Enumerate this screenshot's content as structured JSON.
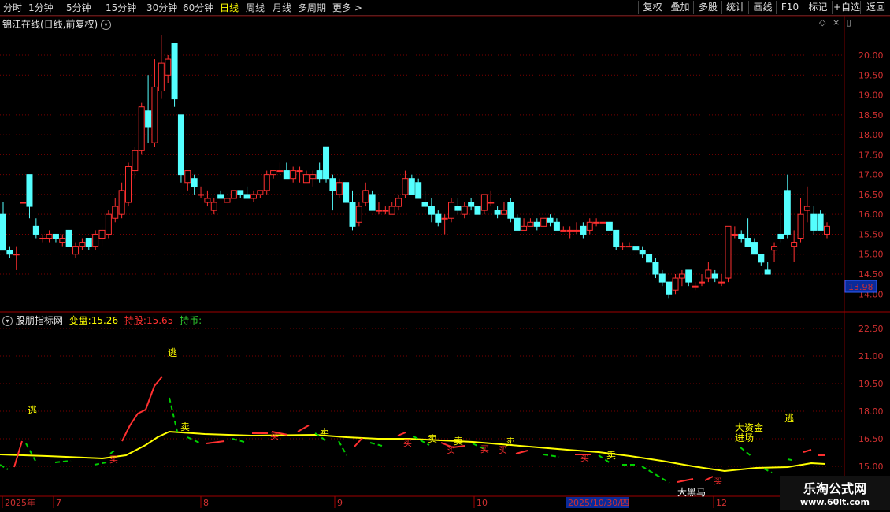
{
  "toolbar": {
    "left_tabs": [
      "分时",
      "1分钟",
      "5分钟",
      "15分钟",
      "30分钟",
      "60分钟",
      "日线",
      "周线",
      "月线",
      "多周期",
      "更多 >"
    ],
    "active_tab": "日线",
    "right_buttons": [
      "复权",
      "叠加",
      "多股",
      "统计",
      "画线",
      "F10",
      "标记",
      "+自选",
      "返回"
    ]
  },
  "main_chart": {
    "title": "锦江在线(日线,前复权)",
    "price_ticks": [
      "20.00",
      "19.50",
      "19.00",
      "18.50",
      "18.00",
      "17.50",
      "17.00",
      "16.50",
      "16.00",
      "15.50",
      "15.00",
      "14.50"
    ],
    "current_price": "13.98",
    "current_price_partial": "14.00"
  },
  "indicator": {
    "name": "股朋指标网",
    "items": [
      {
        "label": "变盘:",
        "value": "15.26",
        "color": "#ffff00"
      },
      {
        "label": "持股:",
        "value": "15.65",
        "color": "#ff3030"
      },
      {
        "label": "持币:",
        "value": "-",
        "color": "#30d030"
      }
    ],
    "ticks": [
      "22.50",
      "21.00",
      "19.50",
      "18.00",
      "16.50",
      "15.00"
    ],
    "annotations": {
      "escape": "逃",
      "sell": "卖",
      "buy": "买",
      "big_fund_line1": "大资金",
      "big_fund_line2": "进场",
      "dark_horse": "大黑马"
    }
  },
  "date_axis": {
    "labels": [
      "2025年",
      "7",
      "8",
      "9",
      "10",
      "12"
    ],
    "highlight": "2025/10/30/四"
  },
  "watermark": {
    "title": "乐淘公式网",
    "url": "www.60lt.com"
  },
  "colors": {
    "up": "#ff3030",
    "down": "#54ffff",
    "grid": "#7a0000",
    "line_yellow": "#ffff00",
    "line_green": "#00d000"
  },
  "chart_data": {
    "type": "candlestick",
    "title": "锦江在线(日线,前复权)",
    "ylim": [
      14.0,
      20.5
    ],
    "candles": [
      {
        "o": 16.0,
        "h": 16.3,
        "l": 15.2,
        "c": 15.1
      },
      {
        "o": 15.1,
        "h": 15.2,
        "l": 14.9,
        "c": 15.0
      },
      {
        "o": 15.0,
        "h": 15.2,
        "l": 14.6,
        "c": 15.0
      },
      {
        "o": 16.3,
        "h": 16.3,
        "l": 16.3,
        "c": 16.3
      },
      {
        "o": 17.0,
        "h": 17.0,
        "l": 15.9,
        "c": 16.2
      },
      {
        "o": 15.7,
        "h": 15.9,
        "l": 15.4,
        "c": 15.5
      },
      {
        "o": 15.4,
        "h": 15.5,
        "l": 15.3,
        "c": 15.4
      },
      {
        "o": 15.4,
        "h": 15.6,
        "l": 15.3,
        "c": 15.5
      },
      {
        "o": 15.5,
        "h": 15.5,
        "l": 15.3,
        "c": 15.4
      },
      {
        "o": 15.3,
        "h": 15.5,
        "l": 15.2,
        "c": 15.4
      },
      {
        "o": 15.6,
        "h": 15.6,
        "l": 15.2,
        "c": 15.2
      },
      {
        "o": 15.0,
        "h": 15.3,
        "l": 14.9,
        "c": 15.2
      },
      {
        "o": 15.2,
        "h": 15.4,
        "l": 15.1,
        "c": 15.3
      },
      {
        "o": 15.4,
        "h": 15.4,
        "l": 15.1,
        "c": 15.2
      },
      {
        "o": 15.2,
        "h": 15.6,
        "l": 15.1,
        "c": 15.5
      },
      {
        "o": 15.4,
        "h": 15.7,
        "l": 15.2,
        "c": 15.6
      },
      {
        "o": 15.5,
        "h": 16.1,
        "l": 15.4,
        "c": 16.0
      },
      {
        "o": 15.9,
        "h": 16.4,
        "l": 15.8,
        "c": 16.2
      },
      {
        "o": 16.0,
        "h": 16.8,
        "l": 15.9,
        "c": 16.6
      },
      {
        "o": 16.3,
        "h": 17.3,
        "l": 16.2,
        "c": 17.2
      },
      {
        "o": 17.1,
        "h": 17.7,
        "l": 16.9,
        "c": 17.6
      },
      {
        "o": 17.6,
        "h": 18.8,
        "l": 17.5,
        "c": 18.7
      },
      {
        "o": 18.6,
        "h": 19.5,
        "l": 17.8,
        "c": 18.2
      },
      {
        "o": 17.8,
        "h": 19.9,
        "l": 17.7,
        "c": 19.2
      },
      {
        "o": 19.1,
        "h": 20.5,
        "l": 18.9,
        "c": 19.8
      },
      {
        "o": 19.5,
        "h": 20.0,
        "l": 19.3,
        "c": 19.9
      },
      {
        "o": 20.3,
        "h": 20.3,
        "l": 18.7,
        "c": 18.9
      },
      {
        "o": 18.5,
        "h": 18.5,
        "l": 16.8,
        "c": 17.0
      },
      {
        "o": 16.8,
        "h": 17.1,
        "l": 16.6,
        "c": 17.1
      },
      {
        "o": 16.9,
        "h": 17.0,
        "l": 16.5,
        "c": 16.7
      },
      {
        "o": 16.5,
        "h": 16.7,
        "l": 16.4,
        "c": 16.5
      },
      {
        "o": 16.3,
        "h": 16.6,
        "l": 16.2,
        "c": 16.4
      },
      {
        "o": 16.1,
        "h": 16.4,
        "l": 16.0,
        "c": 16.3
      },
      {
        "o": 16.5,
        "h": 16.6,
        "l": 16.4,
        "c": 16.4
      },
      {
        "o": 16.3,
        "h": 16.4,
        "l": 16.3,
        "c": 16.4
      },
      {
        "o": 16.4,
        "h": 16.6,
        "l": 16.4,
        "c": 16.6
      },
      {
        "o": 16.6,
        "h": 16.6,
        "l": 16.4,
        "c": 16.5
      },
      {
        "o": 16.5,
        "h": 16.7,
        "l": 16.4,
        "c": 16.4
      },
      {
        "o": 16.4,
        "h": 16.6,
        "l": 16.3,
        "c": 16.5
      },
      {
        "o": 16.5,
        "h": 16.6,
        "l": 16.4,
        "c": 16.6
      },
      {
        "o": 16.6,
        "h": 17.1,
        "l": 16.5,
        "c": 17.0
      },
      {
        "o": 17.0,
        "h": 17.1,
        "l": 16.9,
        "c": 17.1
      },
      {
        "o": 17.1,
        "h": 17.3,
        "l": 17.0,
        "c": 17.1
      },
      {
        "o": 17.1,
        "h": 17.3,
        "l": 16.9,
        "c": 16.9
      },
      {
        "o": 16.9,
        "h": 17.2,
        "l": 16.8,
        "c": 17.1
      },
      {
        "o": 17.1,
        "h": 17.2,
        "l": 16.8,
        "c": 17.1
      },
      {
        "o": 16.8,
        "h": 17.1,
        "l": 16.8,
        "c": 17.0
      },
      {
        "o": 16.9,
        "h": 17.1,
        "l": 16.7,
        "c": 17.0
      },
      {
        "o": 17.1,
        "h": 17.3,
        "l": 16.8,
        "c": 16.9
      },
      {
        "o": 17.7,
        "h": 17.7,
        "l": 16.8,
        "c": 16.9
      },
      {
        "o": 16.9,
        "h": 17.0,
        "l": 16.1,
        "c": 16.6
      },
      {
        "o": 16.5,
        "h": 16.9,
        "l": 16.4,
        "c": 16.8
      },
      {
        "o": 16.8,
        "h": 16.8,
        "l": 16.3,
        "c": 16.3
      },
      {
        "o": 16.3,
        "h": 16.6,
        "l": 15.6,
        "c": 15.7
      },
      {
        "o": 15.8,
        "h": 16.3,
        "l": 15.7,
        "c": 16.2
      },
      {
        "o": 16.3,
        "h": 16.8,
        "l": 16.2,
        "c": 16.6
      },
      {
        "o": 16.5,
        "h": 16.6,
        "l": 16.1,
        "c": 16.1
      },
      {
        "o": 16.1,
        "h": 16.3,
        "l": 16.0,
        "c": 16.1
      },
      {
        "o": 16.1,
        "h": 16.2,
        "l": 16.0,
        "c": 16.1
      },
      {
        "o": 16.0,
        "h": 16.3,
        "l": 16.0,
        "c": 16.2
      },
      {
        "o": 16.2,
        "h": 16.5,
        "l": 16.1,
        "c": 16.4
      },
      {
        "o": 16.5,
        "h": 17.1,
        "l": 16.4,
        "c": 16.9
      },
      {
        "o": 16.9,
        "h": 17.0,
        "l": 16.5,
        "c": 16.5
      },
      {
        "o": 16.8,
        "h": 16.9,
        "l": 16.4,
        "c": 16.4
      },
      {
        "o": 16.3,
        "h": 16.6,
        "l": 16.1,
        "c": 16.2
      },
      {
        "o": 16.2,
        "h": 16.4,
        "l": 15.8,
        "c": 16.0
      },
      {
        "o": 16.0,
        "h": 16.1,
        "l": 15.7,
        "c": 15.8
      },
      {
        "o": 15.9,
        "h": 16.0,
        "l": 15.5,
        "c": 15.9
      },
      {
        "o": 15.9,
        "h": 16.4,
        "l": 15.8,
        "c": 16.3
      },
      {
        "o": 16.2,
        "h": 16.4,
        "l": 16.0,
        "c": 16.1
      },
      {
        "o": 16.0,
        "h": 16.3,
        "l": 15.9,
        "c": 16.2
      },
      {
        "o": 16.3,
        "h": 16.4,
        "l": 16.1,
        "c": 16.2
      },
      {
        "o": 16.2,
        "h": 16.2,
        "l": 16.0,
        "c": 16.0
      },
      {
        "o": 16.1,
        "h": 16.5,
        "l": 16.0,
        "c": 16.5
      },
      {
        "o": 16.3,
        "h": 16.6,
        "l": 16.2,
        "c": 16.3
      },
      {
        "o": 16.1,
        "h": 16.2,
        "l": 15.9,
        "c": 16.0
      },
      {
        "o": 16.0,
        "h": 16.3,
        "l": 16.0,
        "c": 16.1
      },
      {
        "o": 16.3,
        "h": 16.4,
        "l": 15.8,
        "c": 15.9
      },
      {
        "o": 15.9,
        "h": 16.0,
        "l": 15.6,
        "c": 15.6
      },
      {
        "o": 15.6,
        "h": 15.9,
        "l": 15.6,
        "c": 15.7
      },
      {
        "o": 15.7,
        "h": 15.9,
        "l": 15.7,
        "c": 15.8
      },
      {
        "o": 15.8,
        "h": 15.9,
        "l": 15.6,
        "c": 15.7
      },
      {
        "o": 15.7,
        "h": 15.9,
        "l": 15.7,
        "c": 15.9
      },
      {
        "o": 15.9,
        "h": 16.0,
        "l": 15.7,
        "c": 15.8
      },
      {
        "o": 15.8,
        "h": 15.9,
        "l": 15.6,
        "c": 15.6
      },
      {
        "o": 15.6,
        "h": 15.7,
        "l": 15.6,
        "c": 15.6
      },
      {
        "o": 15.6,
        "h": 15.7,
        "l": 15.4,
        "c": 15.6
      },
      {
        "o": 15.6,
        "h": 15.8,
        "l": 15.5,
        "c": 15.6
      },
      {
        "o": 15.7,
        "h": 15.8,
        "l": 15.4,
        "c": 15.5
      },
      {
        "o": 15.6,
        "h": 15.9,
        "l": 15.5,
        "c": 15.8
      },
      {
        "o": 15.8,
        "h": 15.9,
        "l": 15.7,
        "c": 15.8
      },
      {
        "o": 15.8,
        "h": 15.9,
        "l": 15.6,
        "c": 15.8
      },
      {
        "o": 15.8,
        "h": 15.8,
        "l": 15.6,
        "c": 15.6
      },
      {
        "o": 15.6,
        "h": 15.6,
        "l": 15.1,
        "c": 15.2
      },
      {
        "o": 15.2,
        "h": 15.3,
        "l": 15.1,
        "c": 15.2
      },
      {
        "o": 15.2,
        "h": 15.3,
        "l": 15.2,
        "c": 15.2
      },
      {
        "o": 15.2,
        "h": 15.2,
        "l": 15.1,
        "c": 15.1
      },
      {
        "o": 15.1,
        "h": 15.2,
        "l": 14.9,
        "c": 15.0
      },
      {
        "o": 15.0,
        "h": 15.0,
        "l": 14.8,
        "c": 14.8
      },
      {
        "o": 14.8,
        "h": 14.9,
        "l": 14.4,
        "c": 14.5
      },
      {
        "o": 14.5,
        "h": 14.6,
        "l": 14.2,
        "c": 14.3
      },
      {
        "o": 14.3,
        "h": 14.3,
        "l": 13.9,
        "c": 14.0
      },
      {
        "o": 14.1,
        "h": 14.5,
        "l": 14.0,
        "c": 14.4
      },
      {
        "o": 14.4,
        "h": 14.6,
        "l": 14.2,
        "c": 14.5
      },
      {
        "o": 14.6,
        "h": 14.6,
        "l": 14.2,
        "c": 14.3
      },
      {
        "o": 14.2,
        "h": 14.3,
        "l": 14.1,
        "c": 14.2
      },
      {
        "o": 14.3,
        "h": 14.5,
        "l": 14.2,
        "c": 14.3
      },
      {
        "o": 14.4,
        "h": 14.8,
        "l": 14.3,
        "c": 14.6
      },
      {
        "o": 14.5,
        "h": 14.6,
        "l": 14.3,
        "c": 14.4
      },
      {
        "o": 14.3,
        "h": 14.5,
        "l": 14.2,
        "c": 14.3
      },
      {
        "o": 14.4,
        "h": 15.7,
        "l": 14.3,
        "c": 15.7
      },
      {
        "o": 15.5,
        "h": 15.7,
        "l": 15.4,
        "c": 15.5
      },
      {
        "o": 15.5,
        "h": 15.6,
        "l": 15.3,
        "c": 15.4
      },
      {
        "o": 15.4,
        "h": 15.9,
        "l": 15.2,
        "c": 15.2
      },
      {
        "o": 15.3,
        "h": 15.4,
        "l": 15.0,
        "c": 15.0
      },
      {
        "o": 15.0,
        "h": 15.0,
        "l": 14.7,
        "c": 14.8
      },
      {
        "o": 14.6,
        "h": 14.8,
        "l": 14.5,
        "c": 14.5
      },
      {
        "o": 15.1,
        "h": 15.3,
        "l": 14.8,
        "c": 15.2
      },
      {
        "o": 15.5,
        "h": 16.1,
        "l": 15.3,
        "c": 15.4
      },
      {
        "o": 16.6,
        "h": 17.0,
        "l": 15.4,
        "c": 15.5
      },
      {
        "o": 15.2,
        "h": 15.6,
        "l": 14.8,
        "c": 15.3
      },
      {
        "o": 15.4,
        "h": 16.4,
        "l": 15.3,
        "c": 16.0
      },
      {
        "o": 16.1,
        "h": 16.7,
        "l": 15.8,
        "c": 16.2
      },
      {
        "o": 16.0,
        "h": 16.2,
        "l": 15.5,
        "c": 15.6
      },
      {
        "o": 16.0,
        "h": 16.1,
        "l": 15.6,
        "c": 15.6
      },
      {
        "o": 15.5,
        "h": 15.8,
        "l": 15.4,
        "c": 15.7
      }
    ]
  }
}
